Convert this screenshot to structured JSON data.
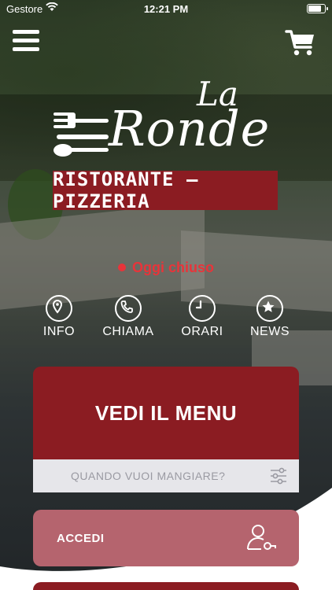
{
  "status_bar": {
    "carrier": "Gestore",
    "time": "12:21 PM",
    "battery_level": 0.9
  },
  "icons": {
    "menu": "hamburger-menu-icon",
    "cart": "shopping-cart-icon"
  },
  "logo": {
    "line1": "La",
    "line2": "Ronde",
    "banner": "RISTORANTE – PIZZERIA"
  },
  "status": {
    "text": "Oggi chiuso",
    "color": "#e8343a"
  },
  "actions": [
    {
      "label": "INFO",
      "icon": "location-pin-icon"
    },
    {
      "label": "CHIAMA",
      "icon": "phone-icon"
    },
    {
      "label": "ORARI",
      "icon": "clock-icon"
    },
    {
      "label": "NEWS",
      "icon": "star-badge-icon"
    }
  ],
  "menu_card": {
    "title": "VEDI IL MENU"
  },
  "when": {
    "placeholder": "QUANDO VUOI MANGIARE?",
    "icon": "filter-sliders-icon"
  },
  "login": {
    "label": "ACCEDI",
    "icon": "user-key-icon"
  },
  "colors": {
    "brand": "#8b1c22",
    "brand_light": "#b5646e",
    "closed": "#e8343a",
    "bar": "#e6e6ea"
  }
}
